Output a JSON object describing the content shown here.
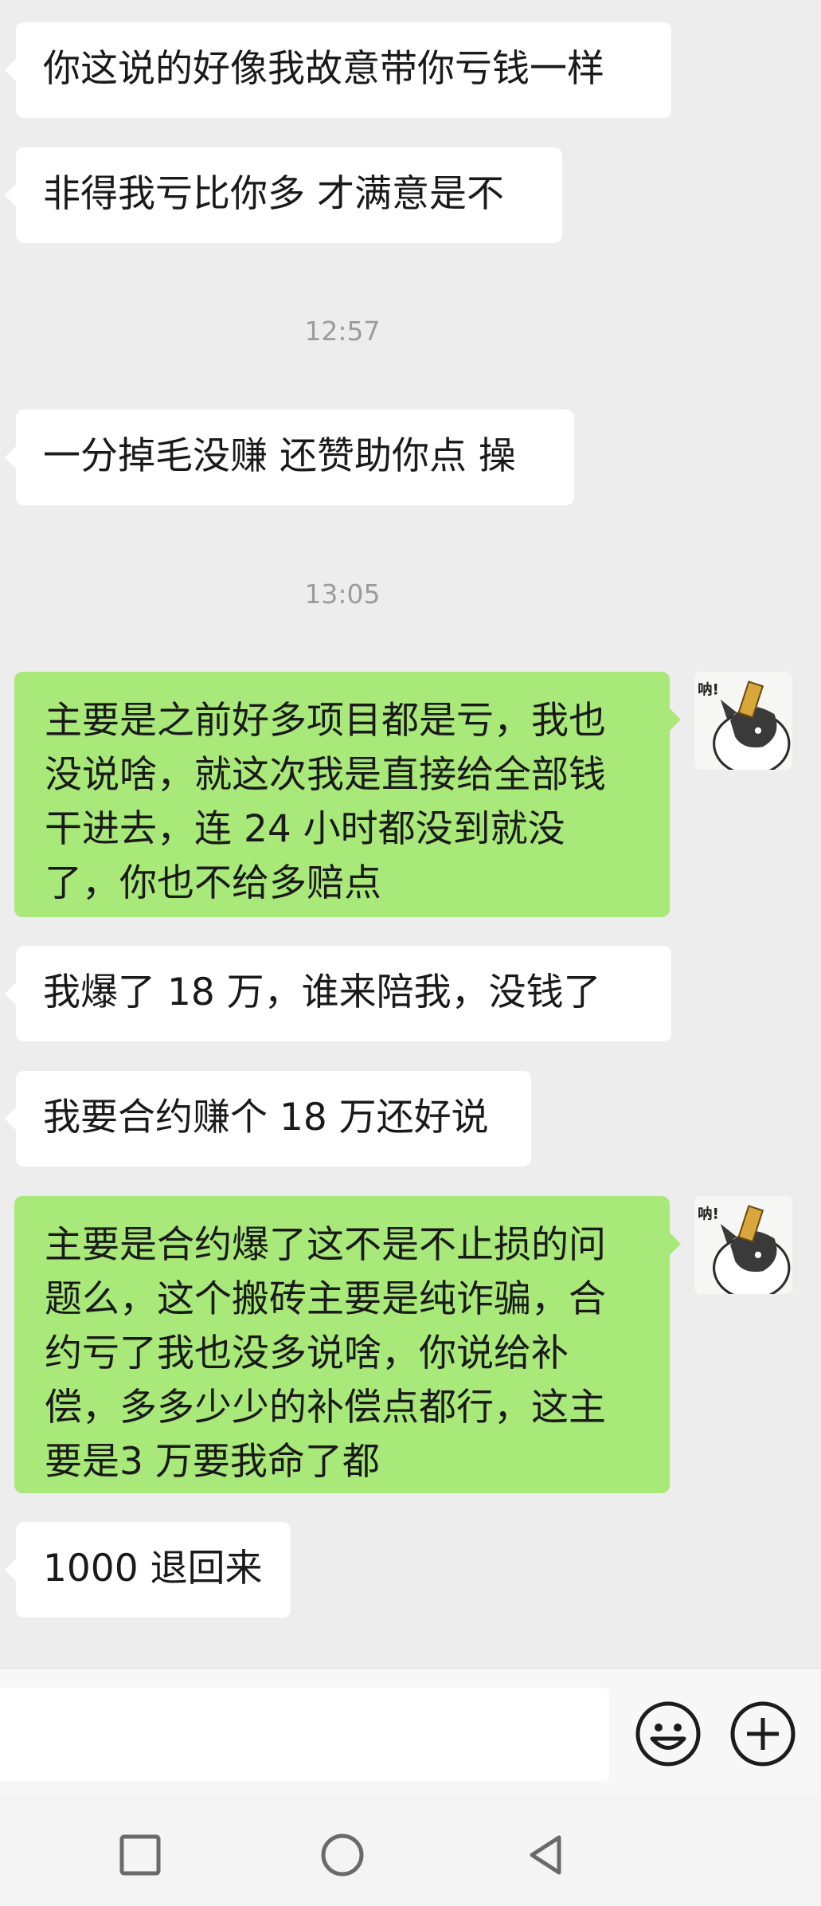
{
  "messages": [
    {
      "side": "in",
      "text": "你这说的好像我故意带你亏钱一样"
    },
    {
      "side": "in",
      "text": "非得我亏比你多 才满意是不"
    },
    {
      "side": "time",
      "text": "12:57"
    },
    {
      "side": "in",
      "text": "一分掉毛没赚 还赞助你点 操"
    },
    {
      "side": "time",
      "text": "13:05"
    },
    {
      "side": "out",
      "text": "主要是之前好多项目都是亏，我也没说啥，就这次我是直接给全部钱干进去，连 24 小时都没到就没了，你也不给多赔点"
    },
    {
      "side": "in",
      "text": "我爆了 18 万，谁来陪我，没钱了"
    },
    {
      "side": "in",
      "text": "我要合约赚个 18 万还好说"
    },
    {
      "side": "out",
      "text": "主要是合约爆了这不是不止损的问题么，这个搬砖主要是纯诈骗，合约亏了我也没多说啥，你说给补偿，多多少少的补偿点都行，这主要是3 万要我命了都"
    },
    {
      "side": "in",
      "text": "1000 退回来"
    }
  ],
  "avatar_sticker_text": "呐!",
  "input_bar": {
    "value": "",
    "emoji_icon": "emoji-icon",
    "plus_icon": "plus-icon"
  },
  "nav_bar": {
    "icons": [
      "recent-apps-icon",
      "home-icon",
      "back-icon"
    ]
  },
  "colors": {
    "background": "#ededed",
    "incoming_bubble": "#ffffff",
    "outgoing_bubble": "#a9e97a",
    "timestamp": "#9c9c9c"
  }
}
